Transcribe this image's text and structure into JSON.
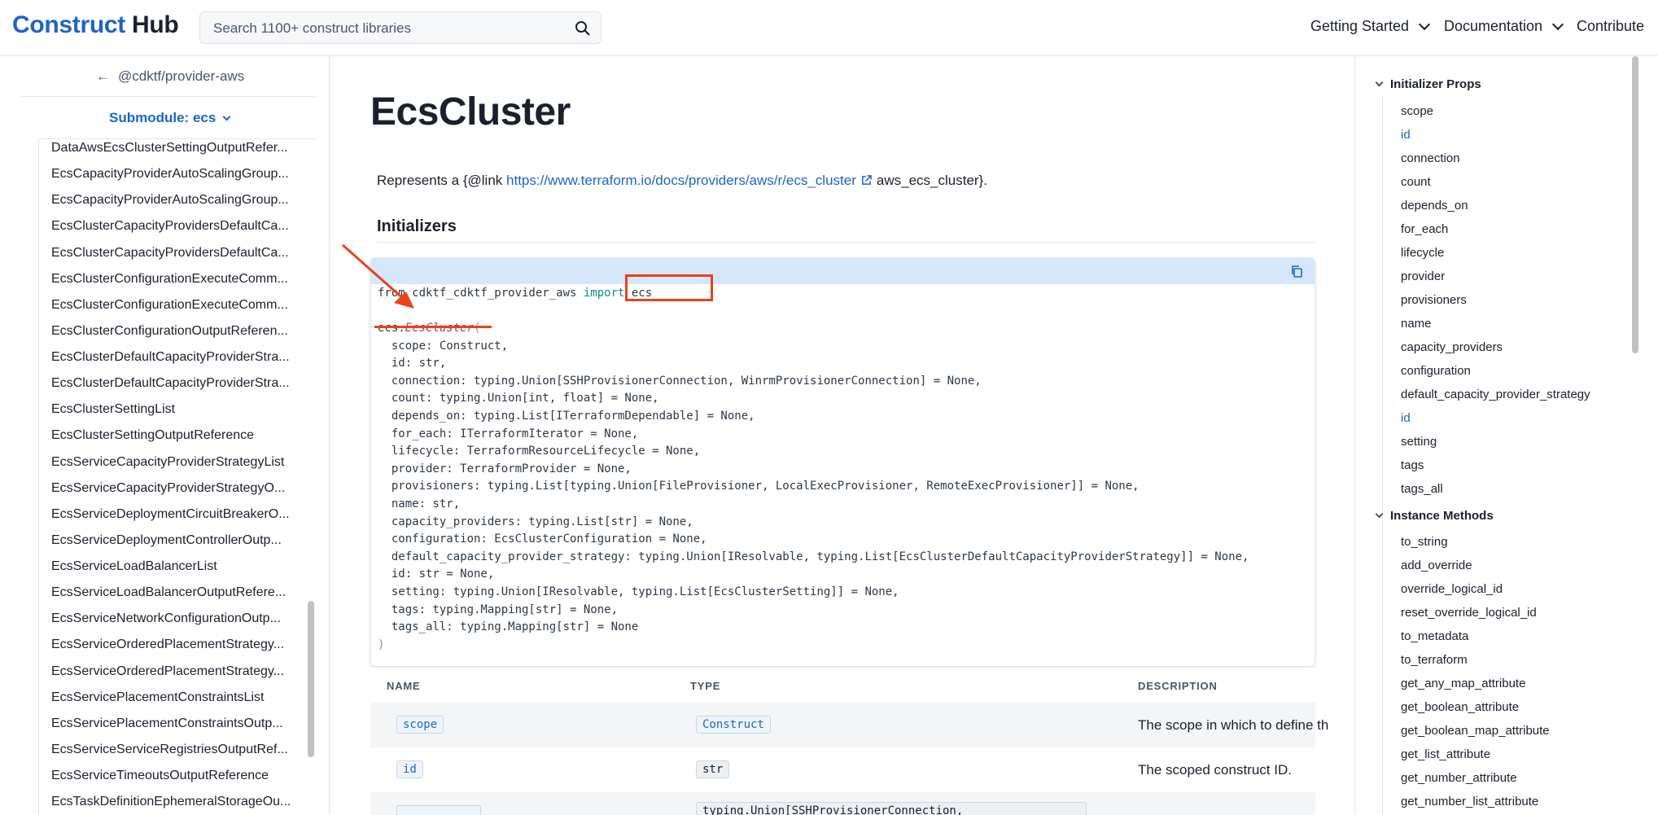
{
  "header": {
    "logo_part1": "Construct",
    "logo_part2": "Hub",
    "search_placeholder": "Search 1100+ construct libraries",
    "nav": [
      "Getting Started",
      "Documentation",
      "Contribute"
    ]
  },
  "sidebar": {
    "back_label": "@cdktf/provider-aws",
    "submodule_label": "Submodule: ecs",
    "items": [
      "DataAwsEcsClusterSettingOutputRefer...",
      "EcsCapacityProviderAutoScalingGroup...",
      "EcsCapacityProviderAutoScalingGroup...",
      "EcsClusterCapacityProvidersDefaultCa...",
      "EcsClusterCapacityProvidersDefaultCa...",
      "EcsClusterConfigurationExecuteComm...",
      "EcsClusterConfigurationExecuteComm...",
      "EcsClusterConfigurationOutputReferen...",
      "EcsClusterDefaultCapacityProviderStra...",
      "EcsClusterDefaultCapacityProviderStra...",
      "EcsClusterSettingList",
      "EcsClusterSettingOutputReference",
      "EcsServiceCapacityProviderStrategyList",
      "EcsServiceCapacityProviderStrategyO...",
      "EcsServiceDeploymentCircuitBreakerO...",
      "EcsServiceDeploymentControllerOutp...",
      "EcsServiceLoadBalancerList",
      "EcsServiceLoadBalancerOutputRefere...",
      "EcsServiceNetworkConfigurationOutp...",
      "EcsServiceOrderedPlacementStrategy...",
      "EcsServiceOrderedPlacementStrategy...",
      "EcsServicePlacementConstraintsList",
      "EcsServicePlacementConstraintsOutp...",
      "EcsServiceServiceRegistriesOutputRef...",
      "EcsServiceTimeoutsOutputReference",
      "EcsTaskDefinitionEphemeralStorageOu..."
    ]
  },
  "main": {
    "title": "EcsCluster",
    "desc_prefix": "Represents a {@link ",
    "desc_link": "https://www.terraform.io/docs/providers/aws/r/ecs_cluster",
    "desc_suffix": "aws_ecs_cluster}.",
    "initializers_heading": "Initializers",
    "code": {
      "import_from": "from cdktf_cdktf_provider_aws ",
      "import_kw": "import",
      "import_mod": " ecs",
      "ctor_obj": "ecs.",
      "ctor_name": "EcsCluster",
      "ctor_open": "(",
      "params": [
        "  scope: Construct,",
        "  id: str,",
        "  connection: typing.Union[SSHProvisionerConnection, WinrmProvisionerConnection] = None,",
        "  count: typing.Union[int, float] = None,",
        "  depends_on: typing.List[ITerraformDependable] = None,",
        "  for_each: ITerraformIterator = None,",
        "  lifecycle: TerraformResourceLifecycle = None,",
        "  provider: TerraformProvider = None,",
        "  provisioners: typing.List[typing.Union[FileProvisioner, LocalExecProvisioner, RemoteExecProvisioner]] = None,",
        "  name: str,",
        "  capacity_providers: typing.List[str] = None,",
        "  configuration: EcsClusterConfiguration = None,",
        "  default_capacity_provider_strategy: typing.Union[IResolvable, typing.List[EcsClusterDefaultCapacityProviderStrategy]] = None,",
        "  id: str = None,",
        "  setting: typing.Union[IResolvable, typing.List[EcsClusterSetting]] = None,",
        "  tags: typing.Mapping[str] = None,",
        "  tags_all: typing.Mapping[str] = None"
      ],
      "ctor_close": ")"
    },
    "table": {
      "headers": [
        "NAME",
        "TYPE",
        "DESCRIPTION"
      ],
      "rows": [
        {
          "name": "scope",
          "type": "Construct",
          "desc": "The scope in which to define th"
        },
        {
          "name": "id",
          "type": "str",
          "desc": "The scoped construct ID."
        },
        {
          "name": "",
          "type": "typing.Union[SSHProvisionerConnection,",
          "desc": ""
        }
      ]
    }
  },
  "toc": {
    "section1": "Initializer Props",
    "props": [
      "scope",
      "id",
      "connection",
      "count",
      "depends_on",
      "for_each",
      "lifecycle",
      "provider",
      "provisioners",
      "name",
      "capacity_providers",
      "configuration",
      "default_capacity_provider_strategy",
      "id",
      "setting",
      "tags",
      "tags_all"
    ],
    "section2": "Instance Methods",
    "methods": [
      "to_string",
      "add_override",
      "override_logical_id",
      "reset_override_logical_id",
      "to_metadata",
      "to_terraform",
      "get_any_map_attribute",
      "get_boolean_attribute",
      "get_boolean_map_attribute",
      "get_list_attribute",
      "get_number_attribute",
      "get_number_list_attribute"
    ]
  },
  "colors": {
    "accent": "#1e64c8",
    "annotation": "#e8431a"
  }
}
